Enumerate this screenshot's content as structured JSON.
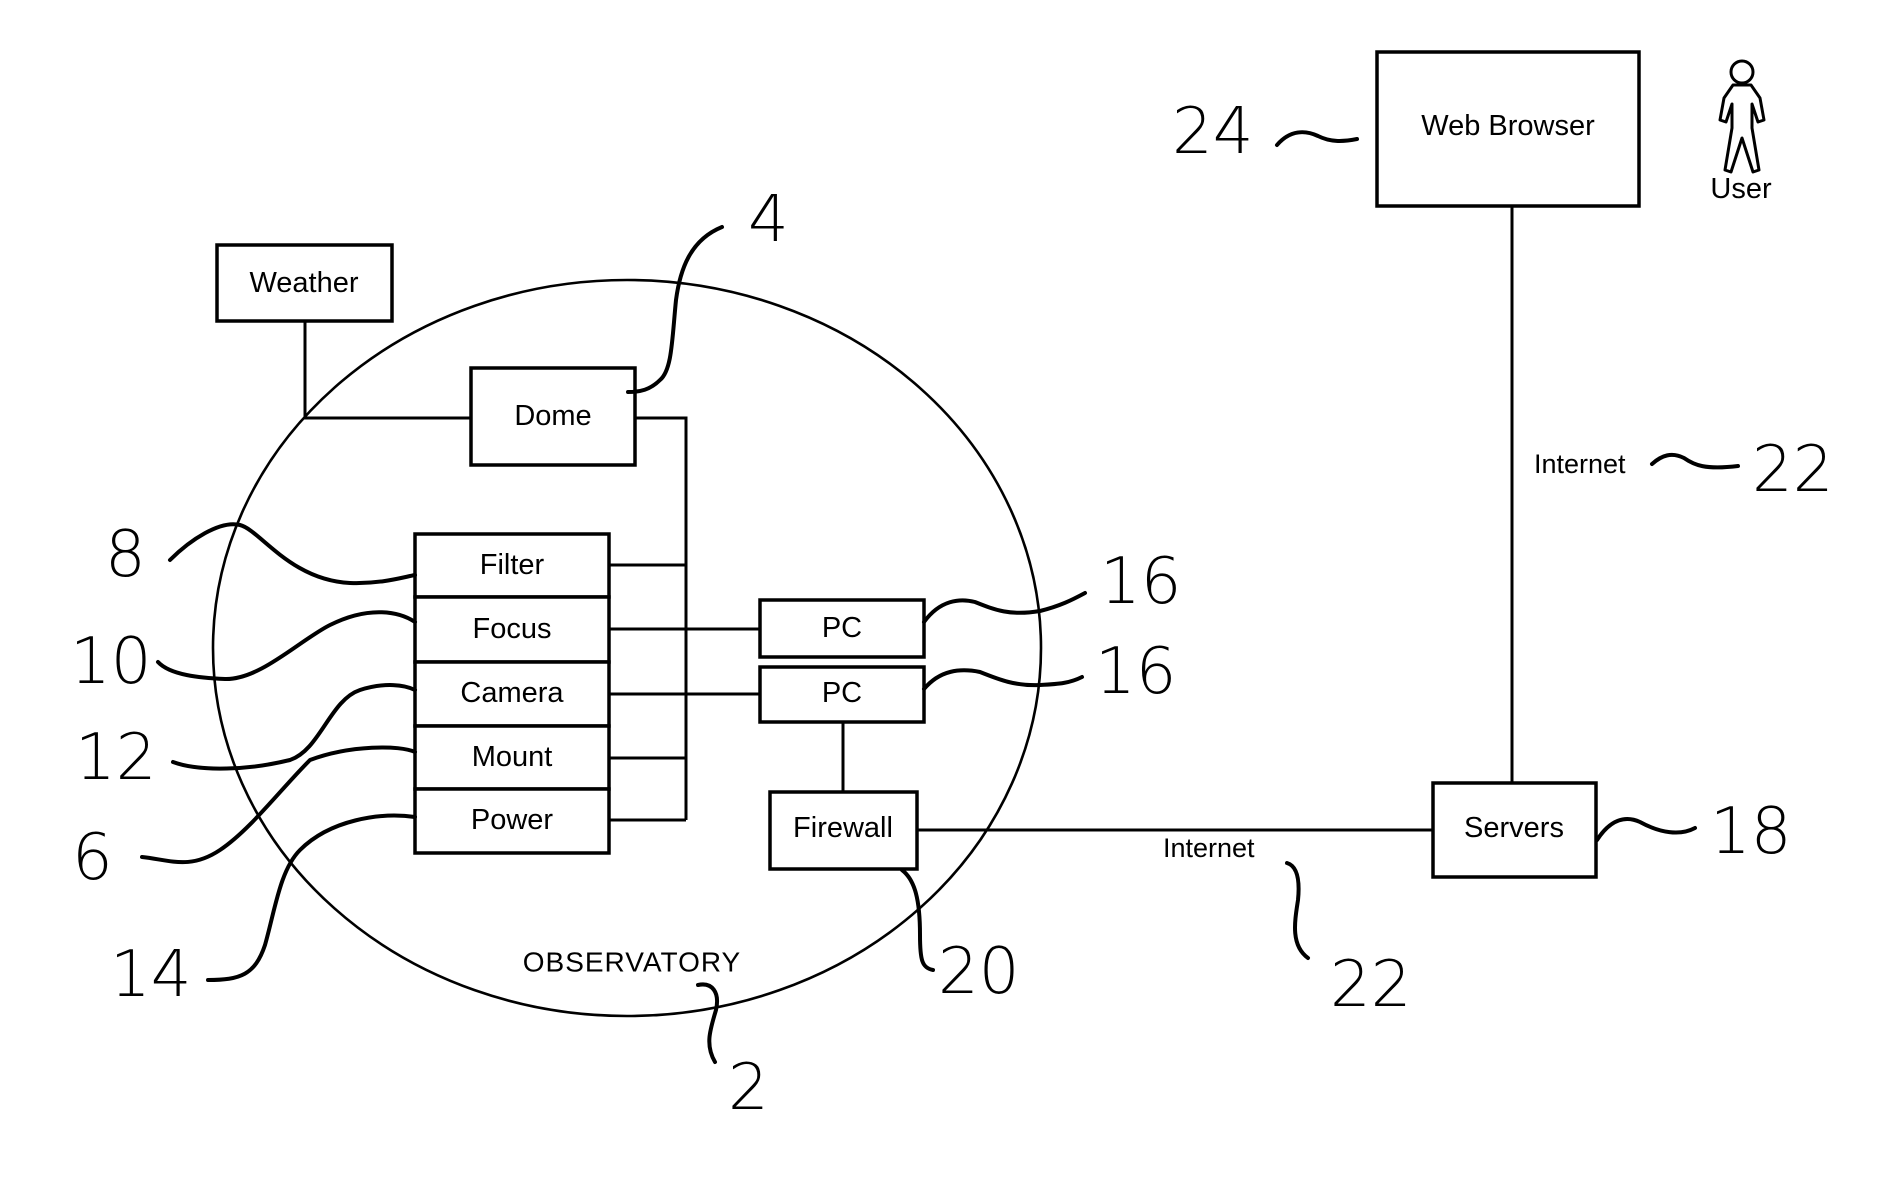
{
  "figure": {
    "region_label": "OBSERVATORY",
    "components": {
      "weather": "Weather",
      "dome": "Dome",
      "filter": "Filter",
      "focus": "Focus",
      "camera": "Camera",
      "mount": "Mount",
      "power": "Power",
      "pc_1": "PC",
      "pc_2": "PC",
      "firewall": "Firewall",
      "servers": "Servers",
      "web_browser": "Web Browser",
      "user": "User"
    },
    "connections": {
      "internet_lower": "Internet",
      "internet_upper": "Internet"
    },
    "reference_numerals": {
      "observatory": "2",
      "dome": "4",
      "mount": "6",
      "filter": "8",
      "focus": "10",
      "camera": "12",
      "power": "14",
      "pc_1": "16",
      "pc_2": "16",
      "servers": "18",
      "firewall": "20",
      "internet_lower": "22",
      "internet_upper": "22",
      "web_browser": "24"
    }
  }
}
